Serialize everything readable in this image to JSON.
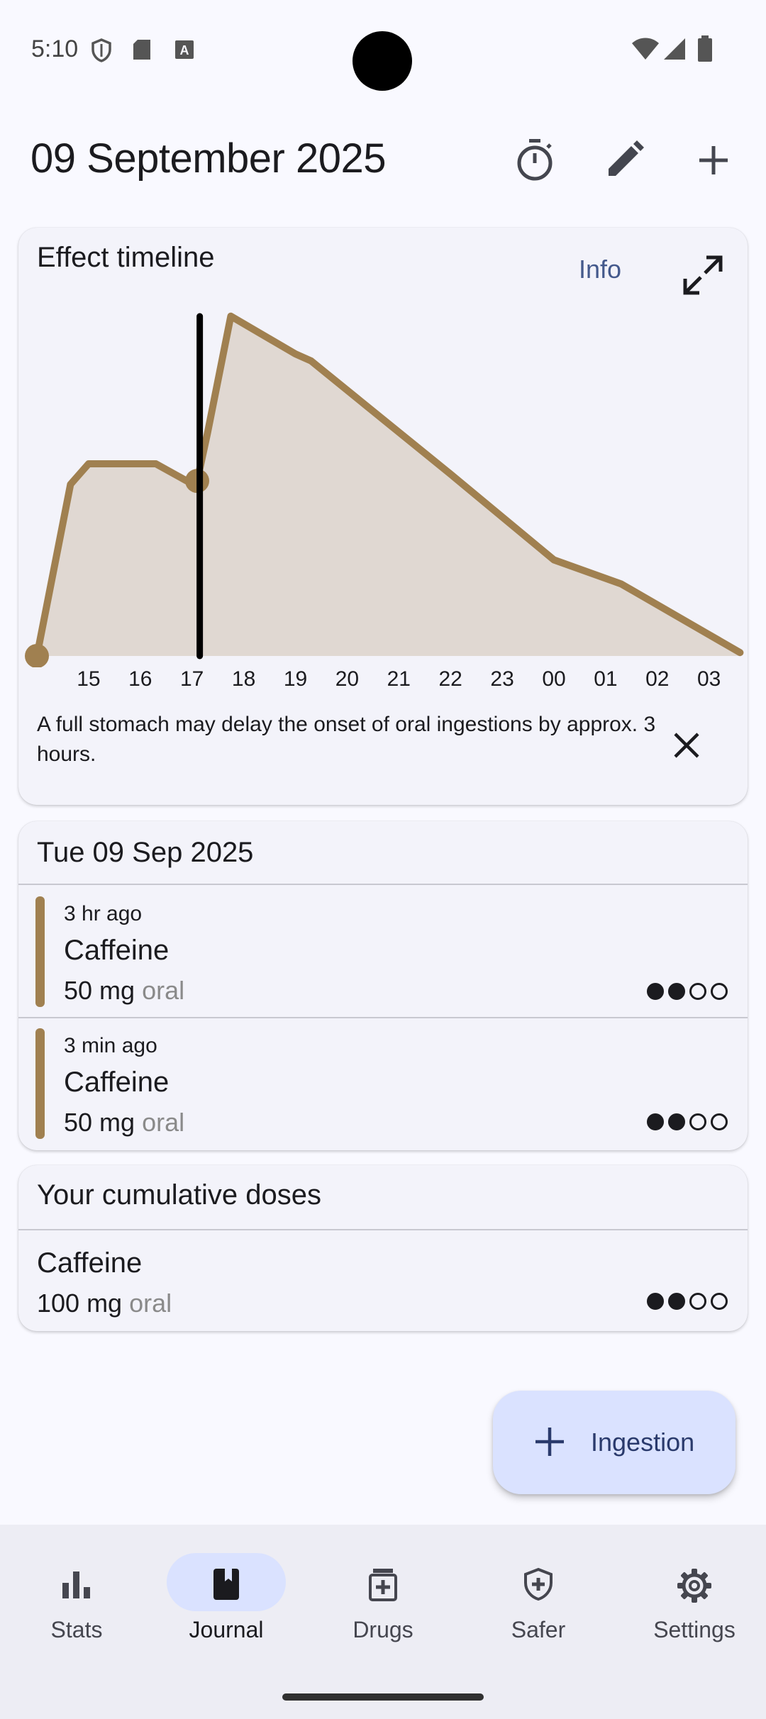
{
  "status_bar": {
    "time": "5:10"
  },
  "header": {
    "title": "09 September 2025",
    "timer_icon": "timer-icon",
    "edit_icon": "pencil-icon",
    "add_icon": "plus-icon"
  },
  "timeline": {
    "title": "Effect timeline",
    "info_label": "Info",
    "expand_icon": "expand-icon",
    "note": "A full stomach may delay the onset of oral ingestions by approx. 3 hours.",
    "close_icon": "close-icon",
    "accent_color": "#a08050",
    "fill_color": "#e0d8d2"
  },
  "chart_data": {
    "type": "area",
    "x_tick_labels": [
      "15",
      "16",
      "17",
      "18",
      "19",
      "20",
      "21",
      "22",
      "23",
      "00",
      "01",
      "02",
      "03"
    ],
    "x_unit": "hour of day",
    "y_range": [
      0,
      1
    ],
    "grid": false,
    "current_time_hour": 17.15,
    "ingestion_marker_hours": [
      14.0,
      17.1
    ],
    "series": [
      {
        "x": [
          14.0,
          14.65,
          15.0,
          15.3,
          16.3,
          16.9,
          17.1,
          17.3,
          17.75,
          19.0,
          19.3,
          22.0,
          24.0,
          25.3,
          27.6
        ],
        "y": [
          0.0,
          0.5,
          0.56,
          0.56,
          0.56,
          0.51,
          0.51,
          0.65,
          0.99,
          0.88,
          0.86,
          0.53,
          0.28,
          0.21,
          0.01
        ]
      }
    ]
  },
  "journal": {
    "date_header": "Tue 09 Sep 2025",
    "entries": [
      {
        "ago": "3 hr ago",
        "substance": "Caffeine",
        "dose": "50 mg",
        "route": "oral",
        "dots_filled": 2,
        "dots_total": 4
      },
      {
        "ago": "3 min ago",
        "substance": "Caffeine",
        "dose": "50 mg",
        "route": "oral",
        "dots_filled": 2,
        "dots_total": 4
      }
    ]
  },
  "cumulative": {
    "title": "Your cumulative doses",
    "items": [
      {
        "substance": "Caffeine",
        "dose": "100 mg",
        "route": "oral",
        "dots_filled": 2,
        "dots_total": 4
      }
    ]
  },
  "fab": {
    "label": "Ingestion",
    "icon": "plus-icon"
  },
  "nav": {
    "items": [
      {
        "label": "Stats",
        "icon": "bar-chart-icon",
        "active": false
      },
      {
        "label": "Journal",
        "icon": "book-icon",
        "active": true
      },
      {
        "label": "Drugs",
        "icon": "medication-icon",
        "active": false
      },
      {
        "label": "Safer",
        "icon": "shield-icon",
        "active": false
      },
      {
        "label": "Settings",
        "icon": "gear-icon",
        "active": false
      }
    ]
  }
}
